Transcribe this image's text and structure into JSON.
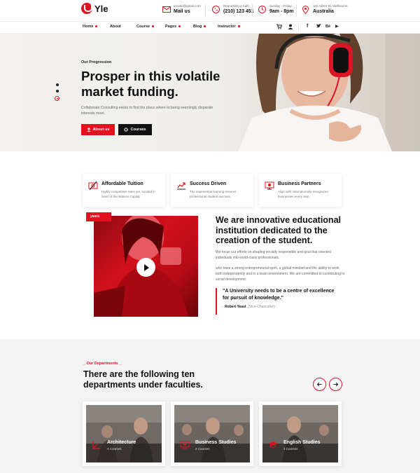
{
  "brand": {
    "name": "Yle"
  },
  "contacts": [
    {
      "label": "envato@gmail.com",
      "value": "Mail us",
      "icon": "mail-icon"
    },
    {
      "label": "Requesting a Call:",
      "value": "(210) 123 451",
      "icon": "phone-icon"
    },
    {
      "label": "Sunday - Friday",
      "value": "9am - 8pm",
      "icon": "clock-icon"
    },
    {
      "label": "122 Albert St, Melbourne",
      "value": "Australia",
      "icon": "location-icon"
    }
  ],
  "nav": {
    "items": [
      "Home",
      "About",
      "Course",
      "Pages",
      "Blog",
      "Instructor"
    ],
    "social": [
      "f",
      "t",
      "Bē",
      "▶"
    ]
  },
  "hero": {
    "subtitle": "Our Progression",
    "title": "Prosper in this volatile market funding.",
    "description": "Collaborate Consulting exists to find the place where to being seemingly disparate interests meet.",
    "btn_primary": "About us",
    "btn_secondary": "Courses"
  },
  "features": [
    {
      "title": "Affordable Tuition",
      "desc": "Highly competitive rates yet, located in heart of the Nations Capital."
    },
    {
      "title": "Success Driven",
      "desc": "The experiential learning ensures professional student success."
    },
    {
      "title": "Business Partners",
      "desc": "Align with internationally-recognized businesses every step."
    }
  ],
  "about": {
    "tag": "years",
    "title": "We are innovative educational institution dedicated to the creation of the student.",
    "p1": "We focus our efforts on shaping socially responsible and goal that oriented individuals into world-class professionals.",
    "p2": "who have a strong entrepreneurial spirit, a global mindset and the ability to work both independently and in a team environment. We are committed to contributing to social development.",
    "quote": "\"A University needs to be a centre of excellence for pursuit of knowledge.\"",
    "author": "Robert Yeast",
    "role": "(Vice-Chancellor)"
  },
  "departments": {
    "subtitle": "_ Our Departments _",
    "title": "There are the following ten departments under faculties.",
    "cards": [
      {
        "title": "Architecture",
        "count": "4 Courses"
      },
      {
        "title": "Business Studies",
        "count": "2 Courses"
      },
      {
        "title": "English Studies",
        "count": "3 Courses"
      }
    ]
  },
  "colors": {
    "accent": "#e3101f",
    "dark": "#111111"
  }
}
